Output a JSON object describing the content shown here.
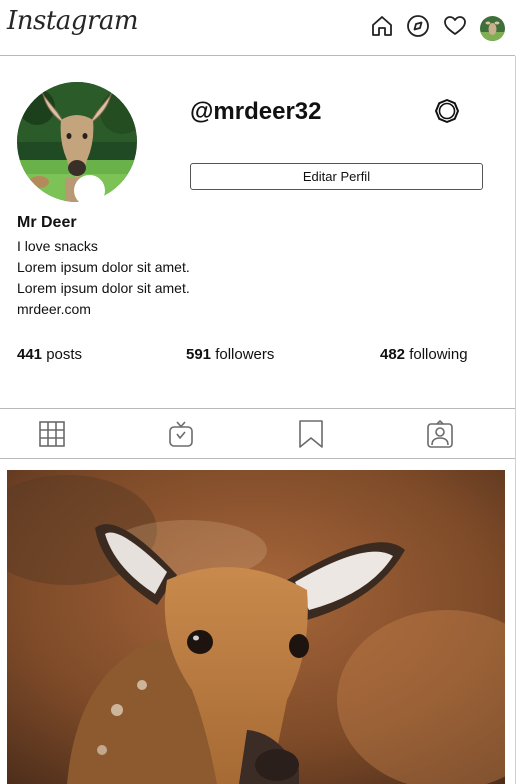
{
  "app": {
    "logo_text": "Instagram"
  },
  "nav": {
    "icons": [
      "home-icon",
      "explore-compass-icon",
      "heart-icon",
      "profile-avatar"
    ]
  },
  "profile": {
    "username": "@mrdeer32",
    "edit_button_label": "Editar Perfil",
    "display_name": "Mr Deer",
    "bio_lines": [
      "I love snacks",
      "Lorem ipsum dolor sit amet.",
      "Lorem ipsum dolor sit amet.",
      "mrdeer.com"
    ],
    "stats": {
      "posts": {
        "count": "441",
        "label": "posts"
      },
      "followers": {
        "count": "591",
        "label": "followers"
      },
      "following": {
        "count": "482",
        "label": "following"
      }
    }
  },
  "tabs": [
    "grid-icon",
    "igtv-icon",
    "bookmark-icon",
    "tagged-user-icon"
  ],
  "colors": {
    "divider": "#b9b9b9",
    "icon": "#6b6b6b",
    "text": "#111111"
  }
}
